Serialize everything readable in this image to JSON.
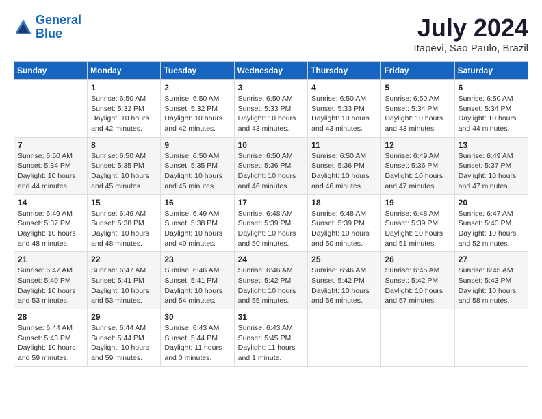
{
  "logo": {
    "line1": "General",
    "line2": "Blue"
  },
  "title": "July 2024",
  "subtitle": "Itapevi, Sao Paulo, Brazil",
  "days_header": [
    "Sunday",
    "Monday",
    "Tuesday",
    "Wednesday",
    "Thursday",
    "Friday",
    "Saturday"
  ],
  "weeks": [
    [
      {
        "num": "",
        "info": ""
      },
      {
        "num": "1",
        "info": "Sunrise: 6:50 AM\nSunset: 5:32 PM\nDaylight: 10 hours\nand 42 minutes."
      },
      {
        "num": "2",
        "info": "Sunrise: 6:50 AM\nSunset: 5:32 PM\nDaylight: 10 hours\nand 42 minutes."
      },
      {
        "num": "3",
        "info": "Sunrise: 6:50 AM\nSunset: 5:33 PM\nDaylight: 10 hours\nand 43 minutes."
      },
      {
        "num": "4",
        "info": "Sunrise: 6:50 AM\nSunset: 5:33 PM\nDaylight: 10 hours\nand 43 minutes."
      },
      {
        "num": "5",
        "info": "Sunrise: 6:50 AM\nSunset: 5:34 PM\nDaylight: 10 hours\nand 43 minutes."
      },
      {
        "num": "6",
        "info": "Sunrise: 6:50 AM\nSunset: 5:34 PM\nDaylight: 10 hours\nand 44 minutes."
      }
    ],
    [
      {
        "num": "7",
        "info": "Sunrise: 6:50 AM\nSunset: 5:34 PM\nDaylight: 10 hours\nand 44 minutes."
      },
      {
        "num": "8",
        "info": "Sunrise: 6:50 AM\nSunset: 5:35 PM\nDaylight: 10 hours\nand 45 minutes."
      },
      {
        "num": "9",
        "info": "Sunrise: 6:50 AM\nSunset: 5:35 PM\nDaylight: 10 hours\nand 45 minutes."
      },
      {
        "num": "10",
        "info": "Sunrise: 6:50 AM\nSunset: 5:36 PM\nDaylight: 10 hours\nand 46 minutes."
      },
      {
        "num": "11",
        "info": "Sunrise: 6:50 AM\nSunset: 5:36 PM\nDaylight: 10 hours\nand 46 minutes."
      },
      {
        "num": "12",
        "info": "Sunrise: 6:49 AM\nSunset: 5:36 PM\nDaylight: 10 hours\nand 47 minutes."
      },
      {
        "num": "13",
        "info": "Sunrise: 6:49 AM\nSunset: 5:37 PM\nDaylight: 10 hours\nand 47 minutes."
      }
    ],
    [
      {
        "num": "14",
        "info": "Sunrise: 6:49 AM\nSunset: 5:37 PM\nDaylight: 10 hours\nand 48 minutes."
      },
      {
        "num": "15",
        "info": "Sunrise: 6:49 AM\nSunset: 5:38 PM\nDaylight: 10 hours\nand 48 minutes."
      },
      {
        "num": "16",
        "info": "Sunrise: 6:49 AM\nSunset: 5:38 PM\nDaylight: 10 hours\nand 49 minutes."
      },
      {
        "num": "17",
        "info": "Sunrise: 6:48 AM\nSunset: 5:39 PM\nDaylight: 10 hours\nand 50 minutes."
      },
      {
        "num": "18",
        "info": "Sunrise: 6:48 AM\nSunset: 5:39 PM\nDaylight: 10 hours\nand 50 minutes."
      },
      {
        "num": "19",
        "info": "Sunrise: 6:48 AM\nSunset: 5:39 PM\nDaylight: 10 hours\nand 51 minutes."
      },
      {
        "num": "20",
        "info": "Sunrise: 6:47 AM\nSunset: 5:40 PM\nDaylight: 10 hours\nand 52 minutes."
      }
    ],
    [
      {
        "num": "21",
        "info": "Sunrise: 6:47 AM\nSunset: 5:40 PM\nDaylight: 10 hours\nand 53 minutes."
      },
      {
        "num": "22",
        "info": "Sunrise: 6:47 AM\nSunset: 5:41 PM\nDaylight: 10 hours\nand 53 minutes."
      },
      {
        "num": "23",
        "info": "Sunrise: 6:46 AM\nSunset: 5:41 PM\nDaylight: 10 hours\nand 54 minutes."
      },
      {
        "num": "24",
        "info": "Sunrise: 6:46 AM\nSunset: 5:42 PM\nDaylight: 10 hours\nand 55 minutes."
      },
      {
        "num": "25",
        "info": "Sunrise: 6:46 AM\nSunset: 5:42 PM\nDaylight: 10 hours\nand 56 minutes."
      },
      {
        "num": "26",
        "info": "Sunrise: 6:45 AM\nSunset: 5:42 PM\nDaylight: 10 hours\nand 57 minutes."
      },
      {
        "num": "27",
        "info": "Sunrise: 6:45 AM\nSunset: 5:43 PM\nDaylight: 10 hours\nand 58 minutes."
      }
    ],
    [
      {
        "num": "28",
        "info": "Sunrise: 6:44 AM\nSunset: 5:43 PM\nDaylight: 10 hours\nand 59 minutes."
      },
      {
        "num": "29",
        "info": "Sunrise: 6:44 AM\nSunset: 5:44 PM\nDaylight: 10 hours\nand 59 minutes."
      },
      {
        "num": "30",
        "info": "Sunrise: 6:43 AM\nSunset: 5:44 PM\nDaylight: 11 hours\nand 0 minutes."
      },
      {
        "num": "31",
        "info": "Sunrise: 6:43 AM\nSunset: 5:45 PM\nDaylight: 11 hours\nand 1 minute."
      },
      {
        "num": "",
        "info": ""
      },
      {
        "num": "",
        "info": ""
      },
      {
        "num": "",
        "info": ""
      }
    ]
  ]
}
